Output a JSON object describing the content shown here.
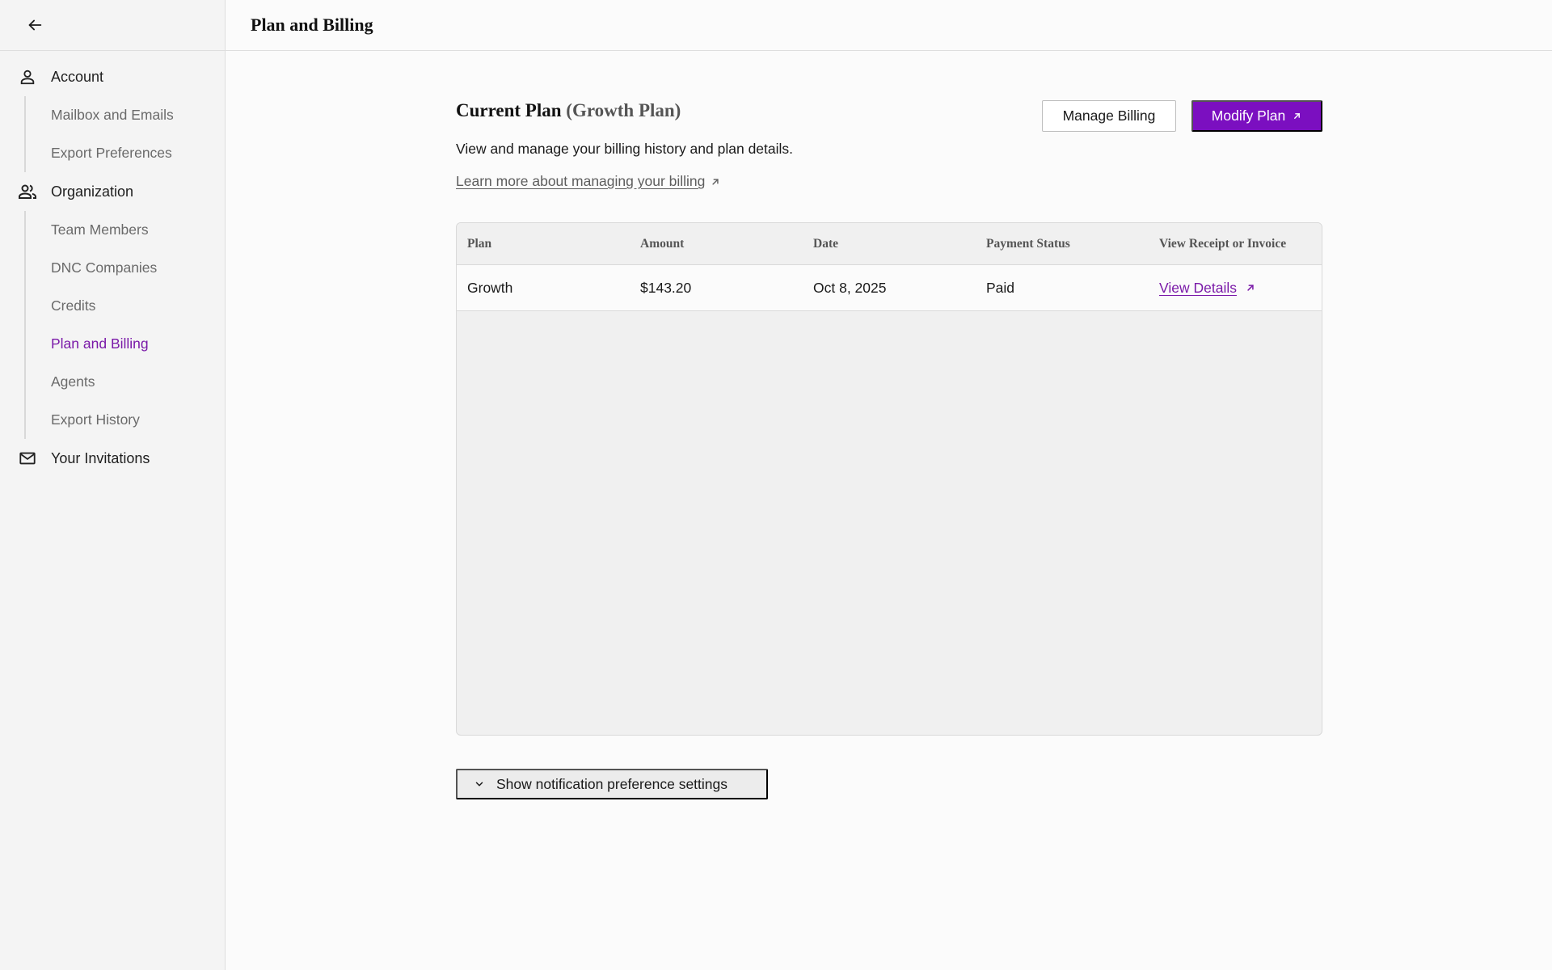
{
  "header": {
    "title": "Plan and Billing"
  },
  "sidebar": {
    "groups": [
      {
        "label": "Account",
        "icon": "person-icon",
        "items": [
          "Mailbox and Emails",
          "Export Preferences"
        ]
      },
      {
        "label": "Organization",
        "icon": "group-icon",
        "items": [
          "Team Members",
          "DNC Companies",
          "Credits",
          "Plan and Billing",
          "Agents",
          "Export History"
        ]
      },
      {
        "label": "Your Invitations",
        "icon": "mail-icon",
        "items": []
      }
    ],
    "active_item": "Plan and Billing"
  },
  "plan": {
    "heading": "Current Plan",
    "plan_name": "(Growth Plan)",
    "description": "View and manage your billing history and plan details.",
    "learn_link": "Learn more about managing your billing",
    "manage_label": "Manage Billing",
    "modify_label": "Modify Plan"
  },
  "table": {
    "columns": [
      "Plan",
      "Amount",
      "Date",
      "Payment Status",
      "View Receipt or Invoice"
    ],
    "rows": [
      {
        "plan": "Growth",
        "amount": "$143.20",
        "date": "Oct 8, 2025",
        "status": "Paid",
        "link": "View Details"
      }
    ]
  },
  "notifications": {
    "toggle_label": "Show notification preference settings"
  },
  "colors": {
    "accent": "#7b0fc0",
    "active_text": "#7a19a8"
  }
}
